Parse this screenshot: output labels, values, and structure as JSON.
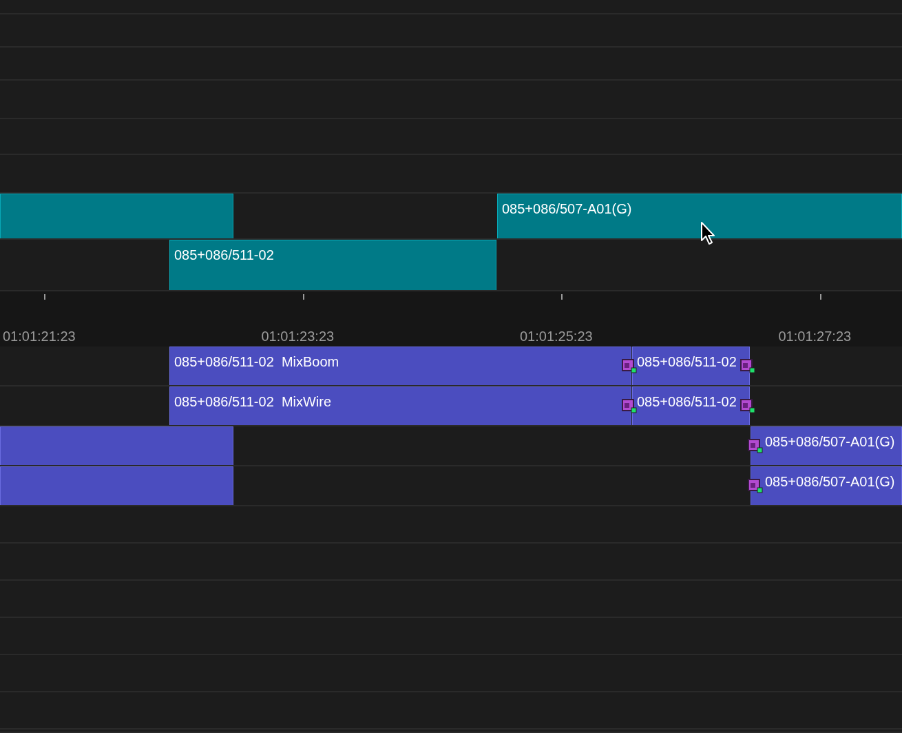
{
  "video_tracks": [
    {
      "clips": [
        {
          "kind": "video"
        },
        {
          "kind": "video",
          "label": "085+086/507-A01(G)"
        }
      ]
    },
    {
      "clips": [
        {
          "kind": "video",
          "label": "085+086/511-02"
        }
      ]
    }
  ],
  "ruler": {
    "timecodes": [
      "01:01:21:23",
      "01:01:23:23",
      "01:01:25:23",
      "01:01:27:23"
    ]
  },
  "audio_tracks": [
    {
      "clips": [
        {
          "label": "085+086/511-02  MixBoom",
          "transition_in": false,
          "transition_out": true
        },
        {
          "label": "085+086/511-02",
          "transition_in": false,
          "transition_out": true
        }
      ]
    },
    {
      "clips": [
        {
          "label": "085+086/511-02  MixWire",
          "transition_in": false,
          "transition_out": true
        },
        {
          "label": "085+086/511-02",
          "transition_in": false,
          "transition_out": true
        }
      ]
    },
    {
      "clips": [
        {
          "transition_in": false,
          "transition_out": false
        },
        {
          "label": "085+086/507-A01(G)",
          "transition_in": true,
          "transition_out": false
        }
      ]
    },
    {
      "clips": [
        {
          "transition_in": false,
          "transition_out": false
        },
        {
          "label": "085+086/507-A01(G)",
          "transition_in": true,
          "transition_out": false
        }
      ]
    }
  ]
}
